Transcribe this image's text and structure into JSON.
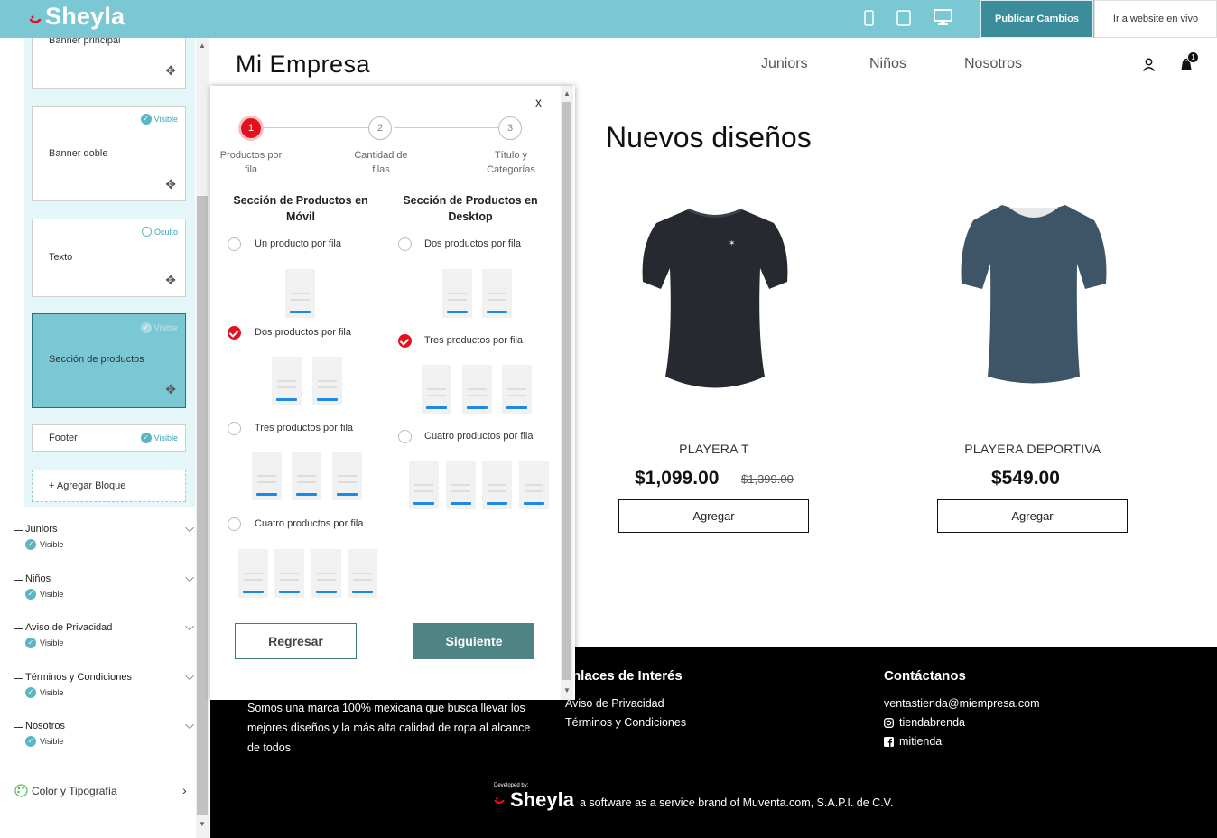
{
  "app": {
    "logo": "Sheyla",
    "publish_label": "Publicar Cambios",
    "live_label": "Ir a website en vivo",
    "devices": [
      "mobile-icon",
      "tablet-icon",
      "desktop-icon"
    ],
    "accent": "#7ac8d4"
  },
  "sidebar": {
    "blocks": [
      {
        "label": "Banner principal",
        "status": ""
      },
      {
        "label": "Banner doble",
        "status": "Visible"
      },
      {
        "label": "Texto",
        "status": "Oculto"
      },
      {
        "label": "Sección de productos",
        "status": "Visible"
      },
      {
        "label": "Footer",
        "status": "Visible"
      }
    ],
    "add_block": "+ Agregar Bloque",
    "pages": [
      {
        "name": "Juniors",
        "status": "Visible"
      },
      {
        "name": "Niños",
        "status": "Visible"
      },
      {
        "name": "Aviso de Privacidad",
        "status": "Visible"
      },
      {
        "name": "Términos y Condiciones",
        "status": "Visible"
      },
      {
        "name": "Nosotros",
        "status": "Visible"
      }
    ],
    "color_tipografia": "Color y Tipografía"
  },
  "store": {
    "name": "Mi Empresa",
    "nav": [
      "Juniors",
      "Niños",
      "Nosotros"
    ],
    "cart_count": "1",
    "section_title": "Nuevos diseños",
    "products": [
      {
        "name": "PLAYERA T",
        "price": "$1,099.00",
        "old_price": "$1,399.00",
        "button": "Agregar"
      },
      {
        "name": "PLAYERA DEPORTIVA",
        "price": "$549.00",
        "old_price": "",
        "button": "Agregar"
      }
    ],
    "footer": {
      "about": "Somos una marca 100% mexicana que busca llevar los mejores diseños y la más alta calidad de ropa al alcance de todos",
      "links_title": "nlaces de Interés",
      "links": [
        "Aviso de Privacidad",
        "Términos y Condiciones"
      ],
      "contact_title": "Contáctanos",
      "email": "ventastienda@miempresa.com",
      "instagram": "tiendabrenda",
      "facebook": "mitienda",
      "developed_by": "Developed by:",
      "brand": "Sheyla",
      "brand_tagline": "a software as a service brand of Muventa.com, S.A.P.I. de C.V."
    }
  },
  "modal": {
    "close": "x",
    "steps": [
      {
        "num": "1",
        "label": "Productos por fila"
      },
      {
        "num": "2",
        "label": "Cantidad de filas"
      },
      {
        "num": "3",
        "label": "Título y Categorías"
      }
    ],
    "mobile_title": "Sección de Productos en Móvil",
    "desktop_title": "Sección de Productos en Desktop",
    "mobile_options": [
      {
        "label": "Un producto por fila",
        "selected": false
      },
      {
        "label": "Dos productos por fila",
        "selected": true
      },
      {
        "label": "Tres productos por fila",
        "selected": false
      },
      {
        "label": "Cuatro productos por fila",
        "selected": false
      }
    ],
    "desktop_options": [
      {
        "label": "Dos productos por fila",
        "selected": false
      },
      {
        "label": "Tres productos por fila",
        "selected": true
      },
      {
        "label": "Cuatro productos por fila",
        "selected": false
      }
    ],
    "back": "Regresar",
    "next": "Siguiente"
  }
}
